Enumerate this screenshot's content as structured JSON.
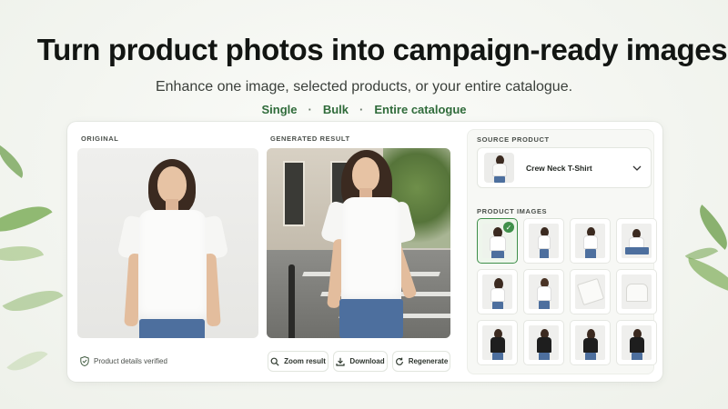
{
  "hero": {
    "title": "Turn product photos into campaign-ready images",
    "subtitle": "Enhance one image, selected products, or your entire catalogue.",
    "modes": [
      "Single",
      "Bulk",
      "Entire catalogue"
    ],
    "mode_separator": "·"
  },
  "editor": {
    "original_label": "ORIGINAL",
    "generated_label": "GENERATED RESULT",
    "verified_text": "Product details verified",
    "buttons": {
      "zoom": "Zoom result",
      "download": "Download",
      "regenerate": "Regenerate"
    }
  },
  "sidebar": {
    "source_label": "SOURCE PRODUCT",
    "source_product": "Crew Neck T-Shirt",
    "images_label": "PRODUCT IMAGES",
    "selected_index": 0
  },
  "icons": {
    "verified": "shield-check-icon",
    "zoom": "search-icon",
    "download": "download-icon",
    "regenerate": "refresh-icon",
    "dropdown": "chevron-down-icon",
    "selected": "check-icon"
  },
  "colors": {
    "accent": "#2f6b3a",
    "check": "#3f8f4a",
    "background": "#f3f5f0"
  }
}
